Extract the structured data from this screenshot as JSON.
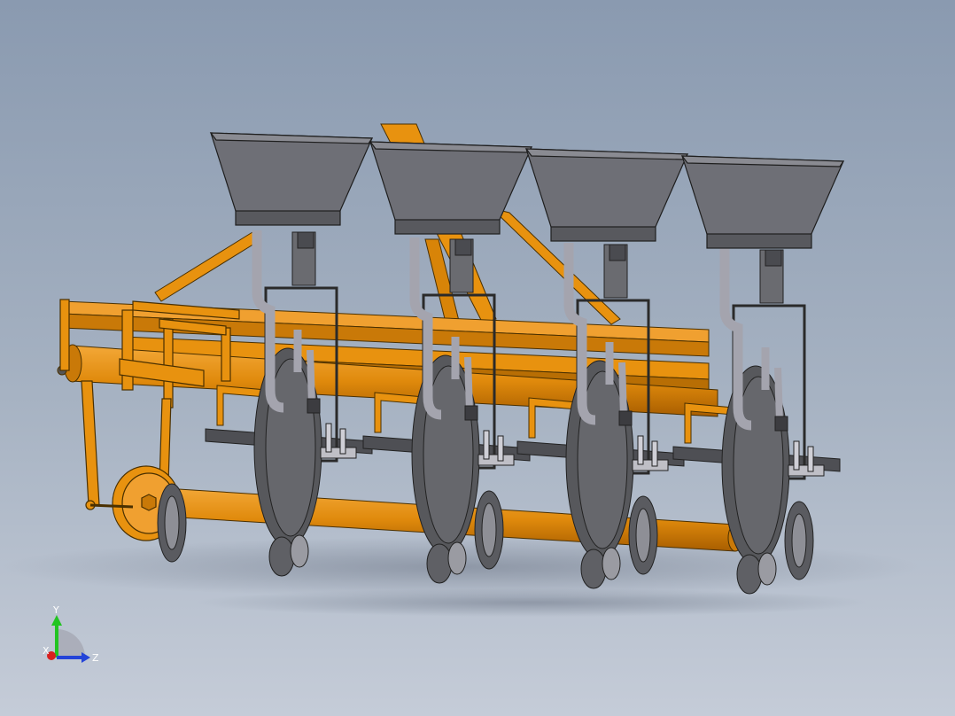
{
  "viewport": {
    "background_top": "#8a9ab0",
    "background_bottom": "#c5ccd8"
  },
  "model": {
    "row_units": 4,
    "frame_color": "#e8920f",
    "hopper_color": "#6e6f76",
    "disc_color": "#57585c",
    "tube_color": "#a4a4ae"
  },
  "triad": {
    "y_label": "Y",
    "z_label": "Z",
    "x_label": "X",
    "y_color": "#22c422",
    "z_color": "#2444d8",
    "x_color": "#d82020"
  }
}
